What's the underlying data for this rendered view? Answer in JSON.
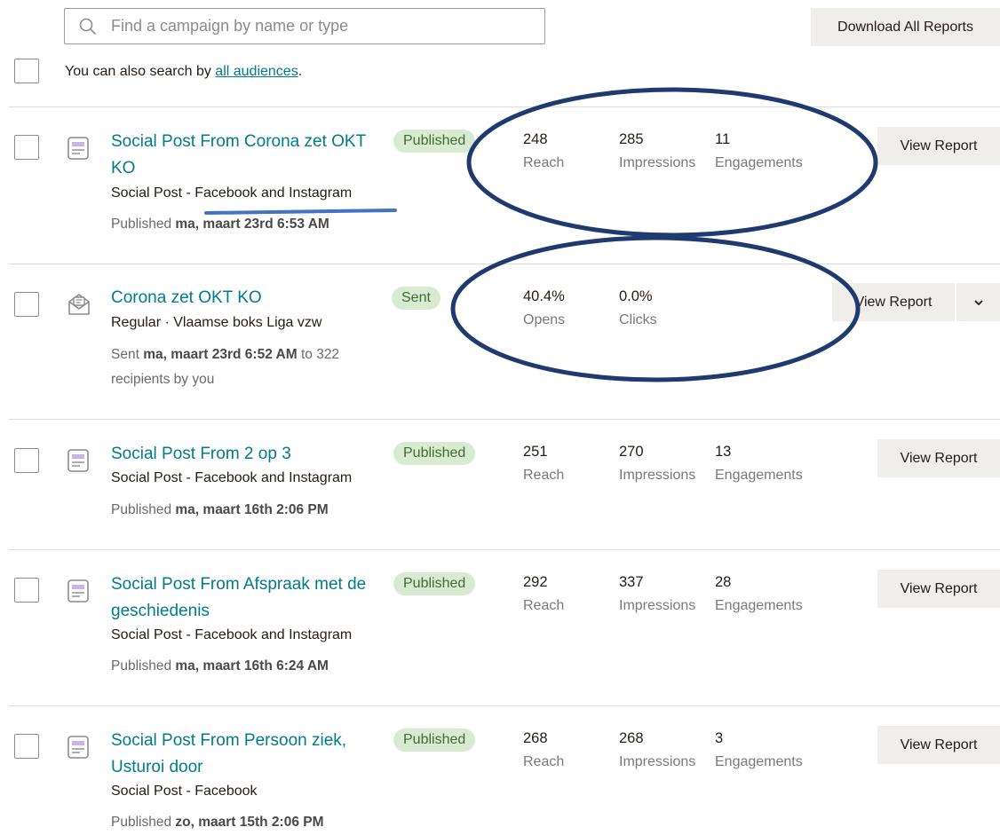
{
  "search": {
    "placeholder": "Find a campaign by name or type"
  },
  "toolbar": {
    "download_label": "Download All Reports"
  },
  "hint": {
    "prefix": "You can also search by ",
    "link": "all audiences",
    "suffix": "."
  },
  "campaigns": [
    {
      "title": "Social Post From Corona zet OKT KO",
      "subtitle": "Social Post - Facebook and Instagram",
      "meta_prefix": "Published ",
      "meta_bold": "ma, maart 23rd 6:53 AM",
      "meta_suffix": "",
      "status": "Published",
      "stats": [
        {
          "value": "248",
          "label": "Reach"
        },
        {
          "value": "285",
          "label": "Impressions"
        },
        {
          "value": "11",
          "label": "Engagements"
        }
      ],
      "action": "View Report"
    },
    {
      "title": "Corona zet OKT KO",
      "subtitle": "Regular · Vlaamse boks Liga vzw",
      "meta_prefix": "Sent ",
      "meta_bold": "ma, maart 23rd 6:52 AM",
      "meta_suffix": " to 322 recipients by you",
      "status": "Sent",
      "stats": [
        {
          "value": "40.4%",
          "label": "Opens"
        },
        {
          "value": "0.0%",
          "label": "Clicks"
        }
      ],
      "action": "View Report"
    },
    {
      "title": "Social Post From 2 op 3",
      "subtitle": "Social Post - Facebook and Instagram",
      "meta_prefix": "Published ",
      "meta_bold": "ma, maart 16th 2:06 PM",
      "meta_suffix": "",
      "status": "Published",
      "stats": [
        {
          "value": "251",
          "label": "Reach"
        },
        {
          "value": "270",
          "label": "Impressions"
        },
        {
          "value": "13",
          "label": "Engagements"
        }
      ],
      "action": "View Report"
    },
    {
      "title": "Social Post From Afspraak met de geschiedenis",
      "subtitle": "Social Post - Facebook and Instagram",
      "meta_prefix": "Published ",
      "meta_bold": "ma, maart 16th 6:24 AM",
      "meta_suffix": "",
      "status": "Published",
      "stats": [
        {
          "value": "292",
          "label": "Reach"
        },
        {
          "value": "337",
          "label": "Impressions"
        },
        {
          "value": "28",
          "label": "Engagements"
        }
      ],
      "action": "View Report"
    },
    {
      "title": "Social Post From Persoon ziek, Usturoi door",
      "subtitle": "Social Post - Facebook",
      "meta_prefix": "Published ",
      "meta_bold": "zo, maart 15th 2:06 PM",
      "meta_suffix": "",
      "status": "Published",
      "stats": [
        {
          "value": "268",
          "label": "Reach"
        },
        {
          "value": "268",
          "label": "Impressions"
        },
        {
          "value": "3",
          "label": "Engagements"
        }
      ],
      "action": "View Report"
    }
  ]
}
